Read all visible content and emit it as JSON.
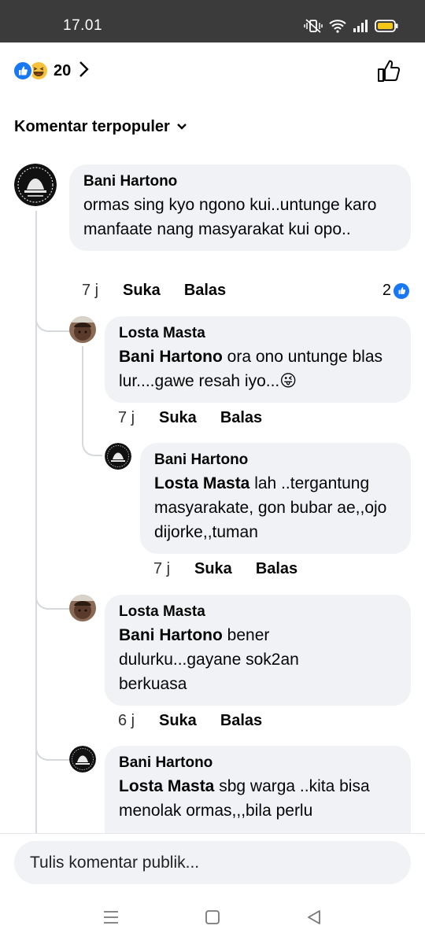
{
  "status_bar": {
    "time": "17.01"
  },
  "reactions": {
    "count": "20",
    "icons": [
      "like-reaction-icon",
      "haha-reaction-icon"
    ]
  },
  "sort": {
    "label": "Komentar terpopuler"
  },
  "comments": [
    {
      "author": "Bani Hartono",
      "text": "ormas sing kyo ngono kui..untunge karo manfaate nang masyarakat kui opo..",
      "time": "7 j",
      "like": "Suka",
      "reply": "Balas",
      "like_count": "2"
    },
    {
      "author": "Losta Masta",
      "mention": "Bani Hartono",
      "text": " ora ono untunge blas lur....gawe resah iyo...😜",
      "time": "7 j",
      "like": "Suka",
      "reply": "Balas"
    },
    {
      "author": "Bani Hartono",
      "mention": "Losta Masta",
      "text": " lah ..tergantung masyarakate, gon bubar ae,,ojo dijorke,,tuman",
      "time": "7 j",
      "like": "Suka",
      "reply": "Balas"
    },
    {
      "author": "Losta Masta",
      "mention": "Bani Hartono",
      "text": " bener dulurku...gayane sok2an berkuasa",
      "time": "6 j",
      "like": "Suka",
      "reply": "Balas"
    },
    {
      "author": "Bani Hartono",
      "mention": "Losta Masta",
      "text": " sbg warga ..kita bisa menolak ormas,,,bila perlu"
    }
  ],
  "composer": {
    "placeholder": "Tulis komentar publik..."
  },
  "colors": {
    "accent": "#1877f2",
    "bubble": "#f0f2f5",
    "status_bar": "#3b3b3b"
  }
}
